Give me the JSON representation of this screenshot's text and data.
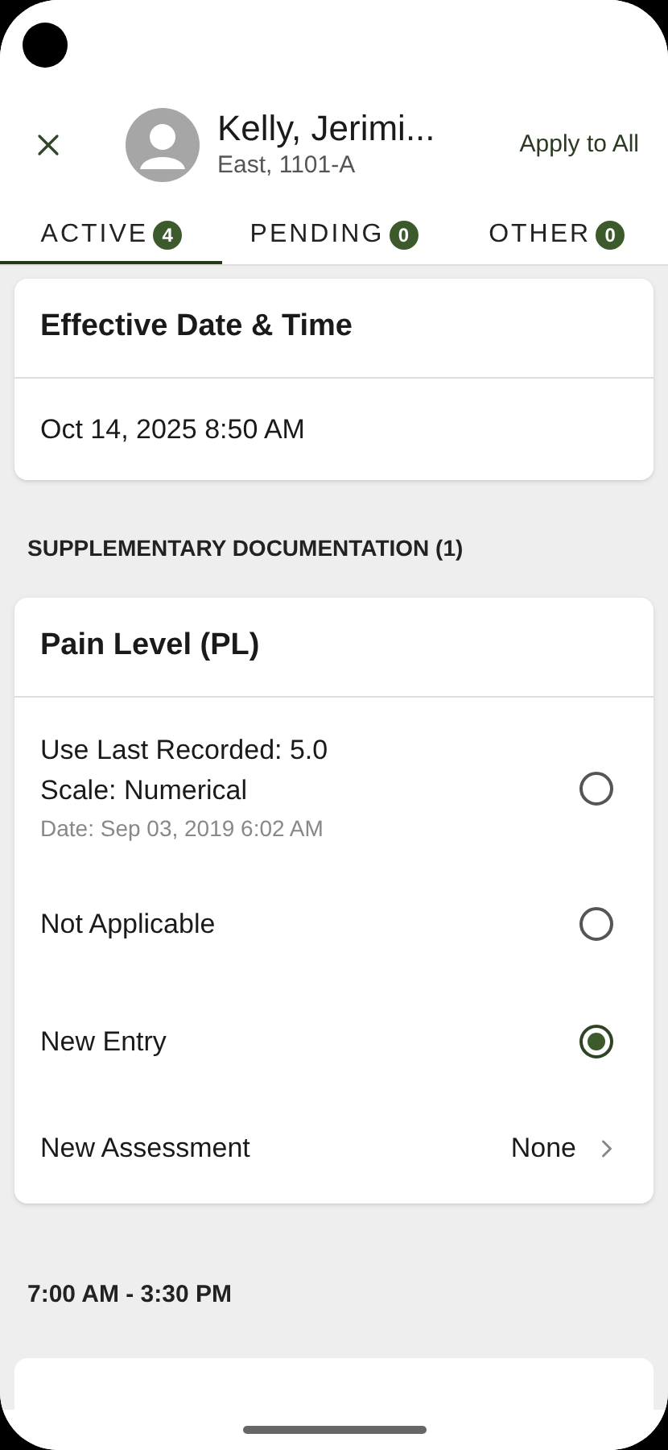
{
  "header": {
    "name": "Kelly, Jerimi...",
    "location": "East, 1101-A",
    "action": "Apply to All"
  },
  "tabs": [
    {
      "label": "ACTIVE",
      "count": "4",
      "selected": true
    },
    {
      "label": "PENDING",
      "count": "0",
      "selected": false
    },
    {
      "label": "OTHER",
      "count": "0",
      "selected": false
    }
  ],
  "effective": {
    "title": "Effective Date & Time",
    "value": "Oct 14, 2025 8:50 AM"
  },
  "section_label": "SUPPLEMENTARY DOCUMENTATION (1)",
  "pain": {
    "title": "Pain Level (PL)",
    "options": [
      {
        "lines": [
          "Use Last Recorded: 5.0",
          "Scale: Numerical"
        ],
        "note": "Date: Sep 03, 2019 6:02 AM",
        "selected": false
      },
      {
        "lines": [
          "Not Applicable"
        ],
        "selected": false
      },
      {
        "lines": [
          "New Entry"
        ],
        "selected": true
      }
    ],
    "assessment": {
      "label": "New Assessment",
      "value": "None"
    }
  },
  "time_label": "7:00 AM - 3:30 PM"
}
